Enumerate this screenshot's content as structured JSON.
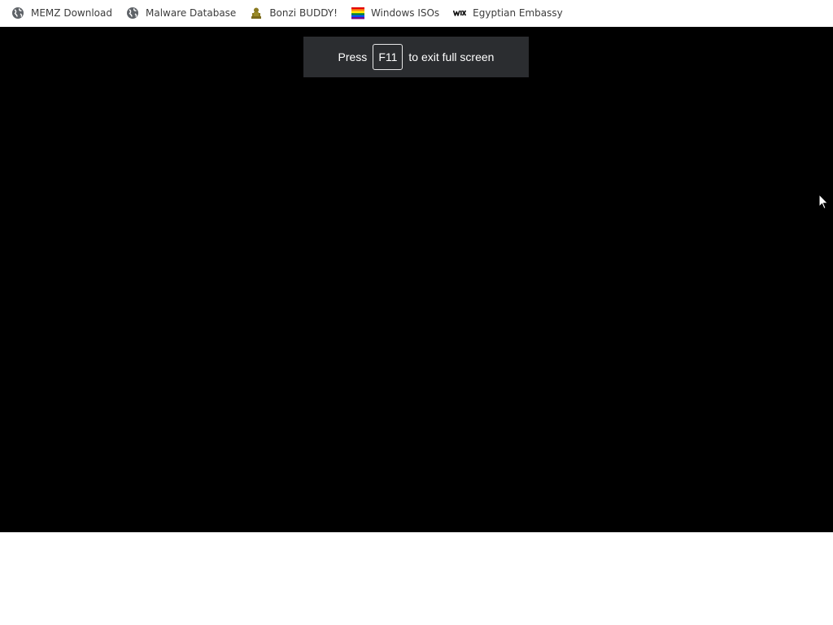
{
  "bookmarks": [
    {
      "label": "MEMZ Download",
      "icon": "globe-icon"
    },
    {
      "label": "Malware Database",
      "icon": "globe-icon"
    },
    {
      "label": "Bonzi BUDDY!",
      "icon": "bonzi-icon"
    },
    {
      "label": "Windows ISOs",
      "icon": "rainbow-flag-icon"
    },
    {
      "label": "Egyptian Embassy",
      "icon": "wix-icon"
    }
  ],
  "toast": {
    "prefix": "Press",
    "key": "F11",
    "suffix": "to exit full screen"
  },
  "colors": {
    "video_bg": "#000000",
    "toast_bg": "#2b2d30",
    "bookmark_text": "#3c3c3c"
  }
}
